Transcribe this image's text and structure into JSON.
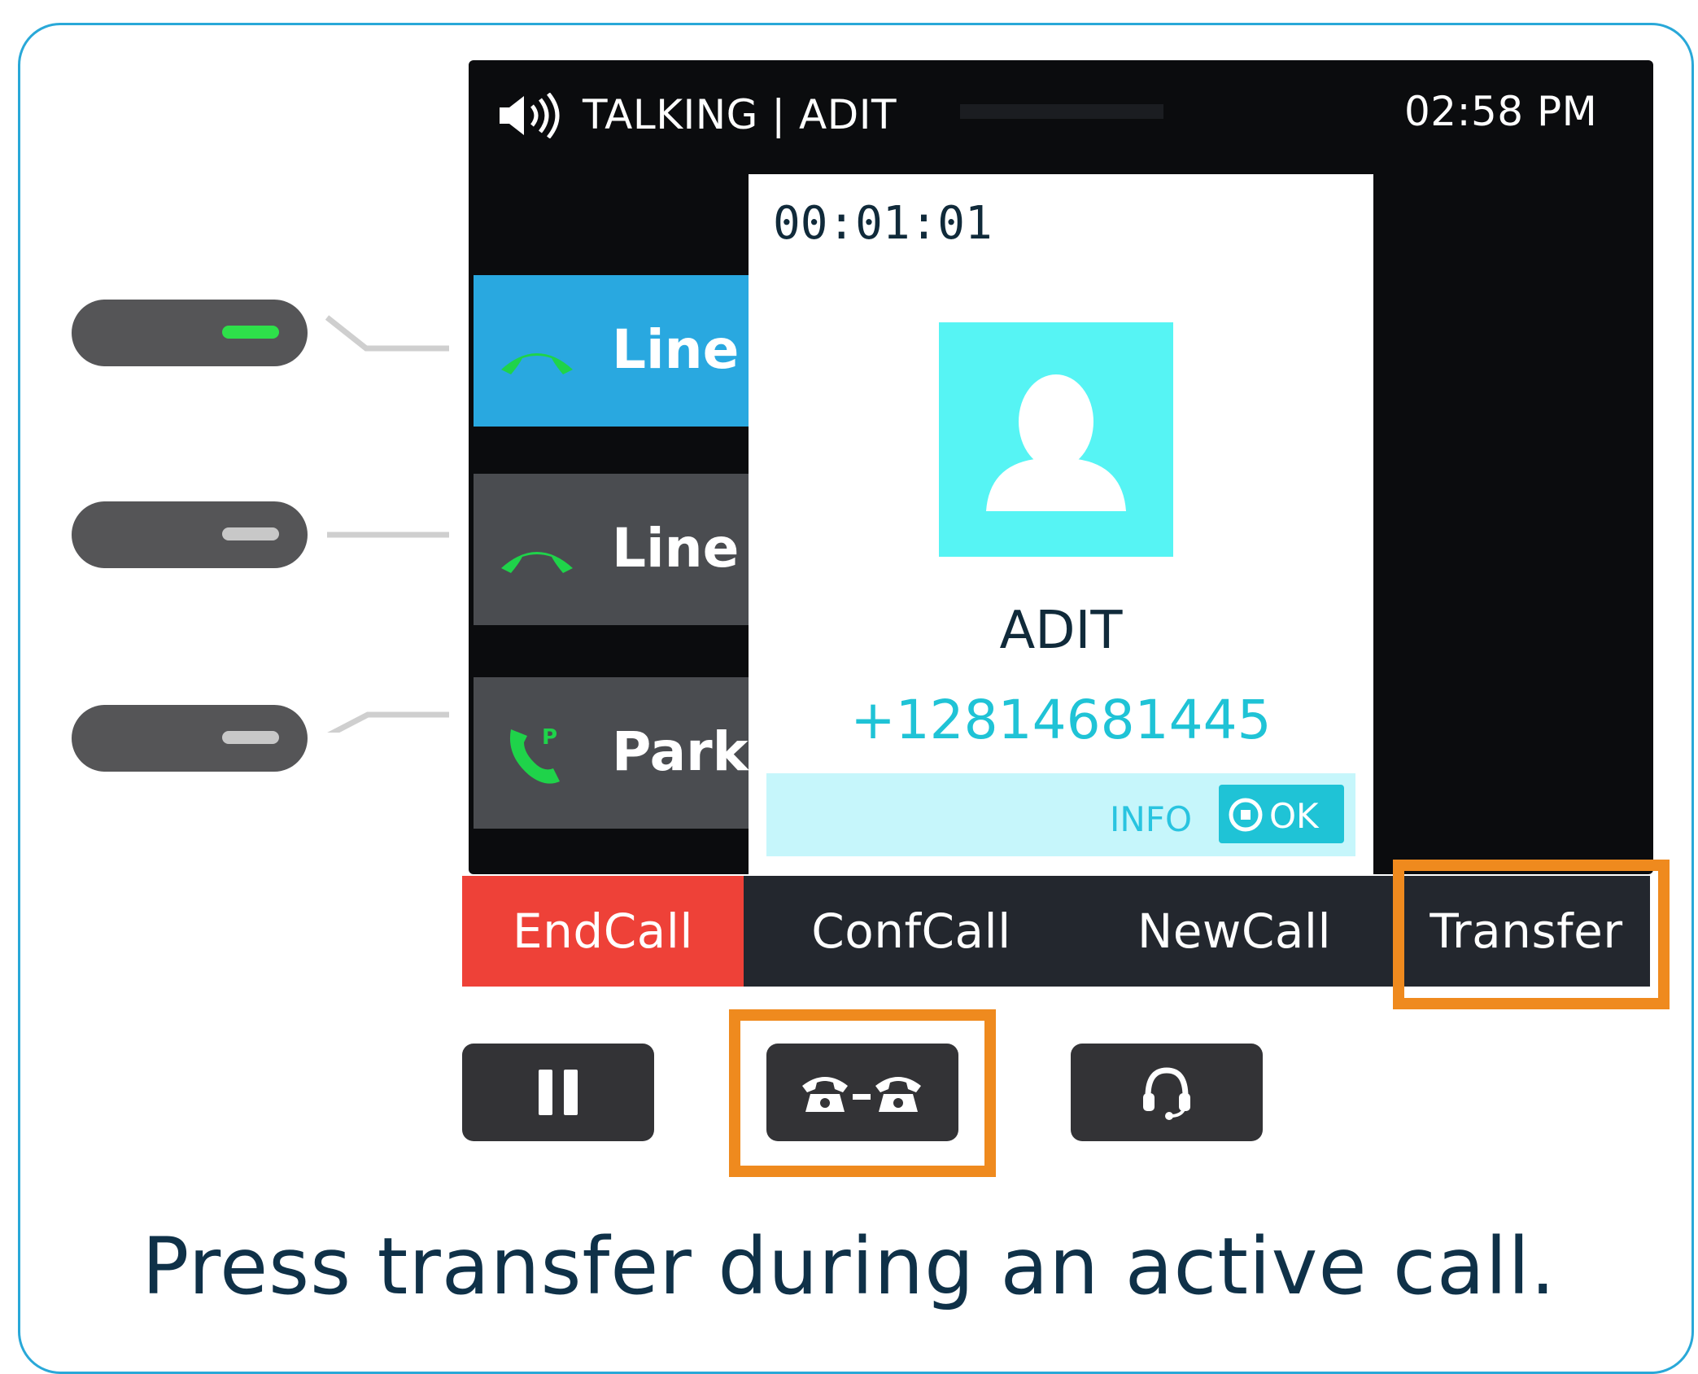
{
  "status_bar": {
    "state": "TALKING | ADIT",
    "time": "02:58 PM"
  },
  "lines": [
    {
      "label": "Line",
      "icon": "handset-green-icon",
      "active": true
    },
    {
      "label": "Line",
      "icon": "handset-green-icon",
      "active": false
    },
    {
      "label": "Park",
      "icon": "park-phone-icon",
      "active": false
    }
  ],
  "call_popup": {
    "timer": "00:01:01",
    "contact_name": "ADIT",
    "contact_number": "+12814681445",
    "info_label": "INFO",
    "ok_label": "OK"
  },
  "softkeys": {
    "end_call": "EndCall",
    "conf_call": "ConfCall",
    "new_call": "NewCall",
    "transfer": "Transfer"
  },
  "hardware_buttons": [
    "pause-icon",
    "transfer-phones-icon",
    "headset-icon"
  ],
  "caption": "Press transfer during an active call.",
  "colors": {
    "accent_blue": "#29a8d8",
    "highlight_orange": "#ef8a1e",
    "end_call_red": "#ee4138",
    "avatar_cyan": "#56f4f4",
    "number_cyan": "#1fc3d6",
    "led_green": "#2ee04a"
  }
}
